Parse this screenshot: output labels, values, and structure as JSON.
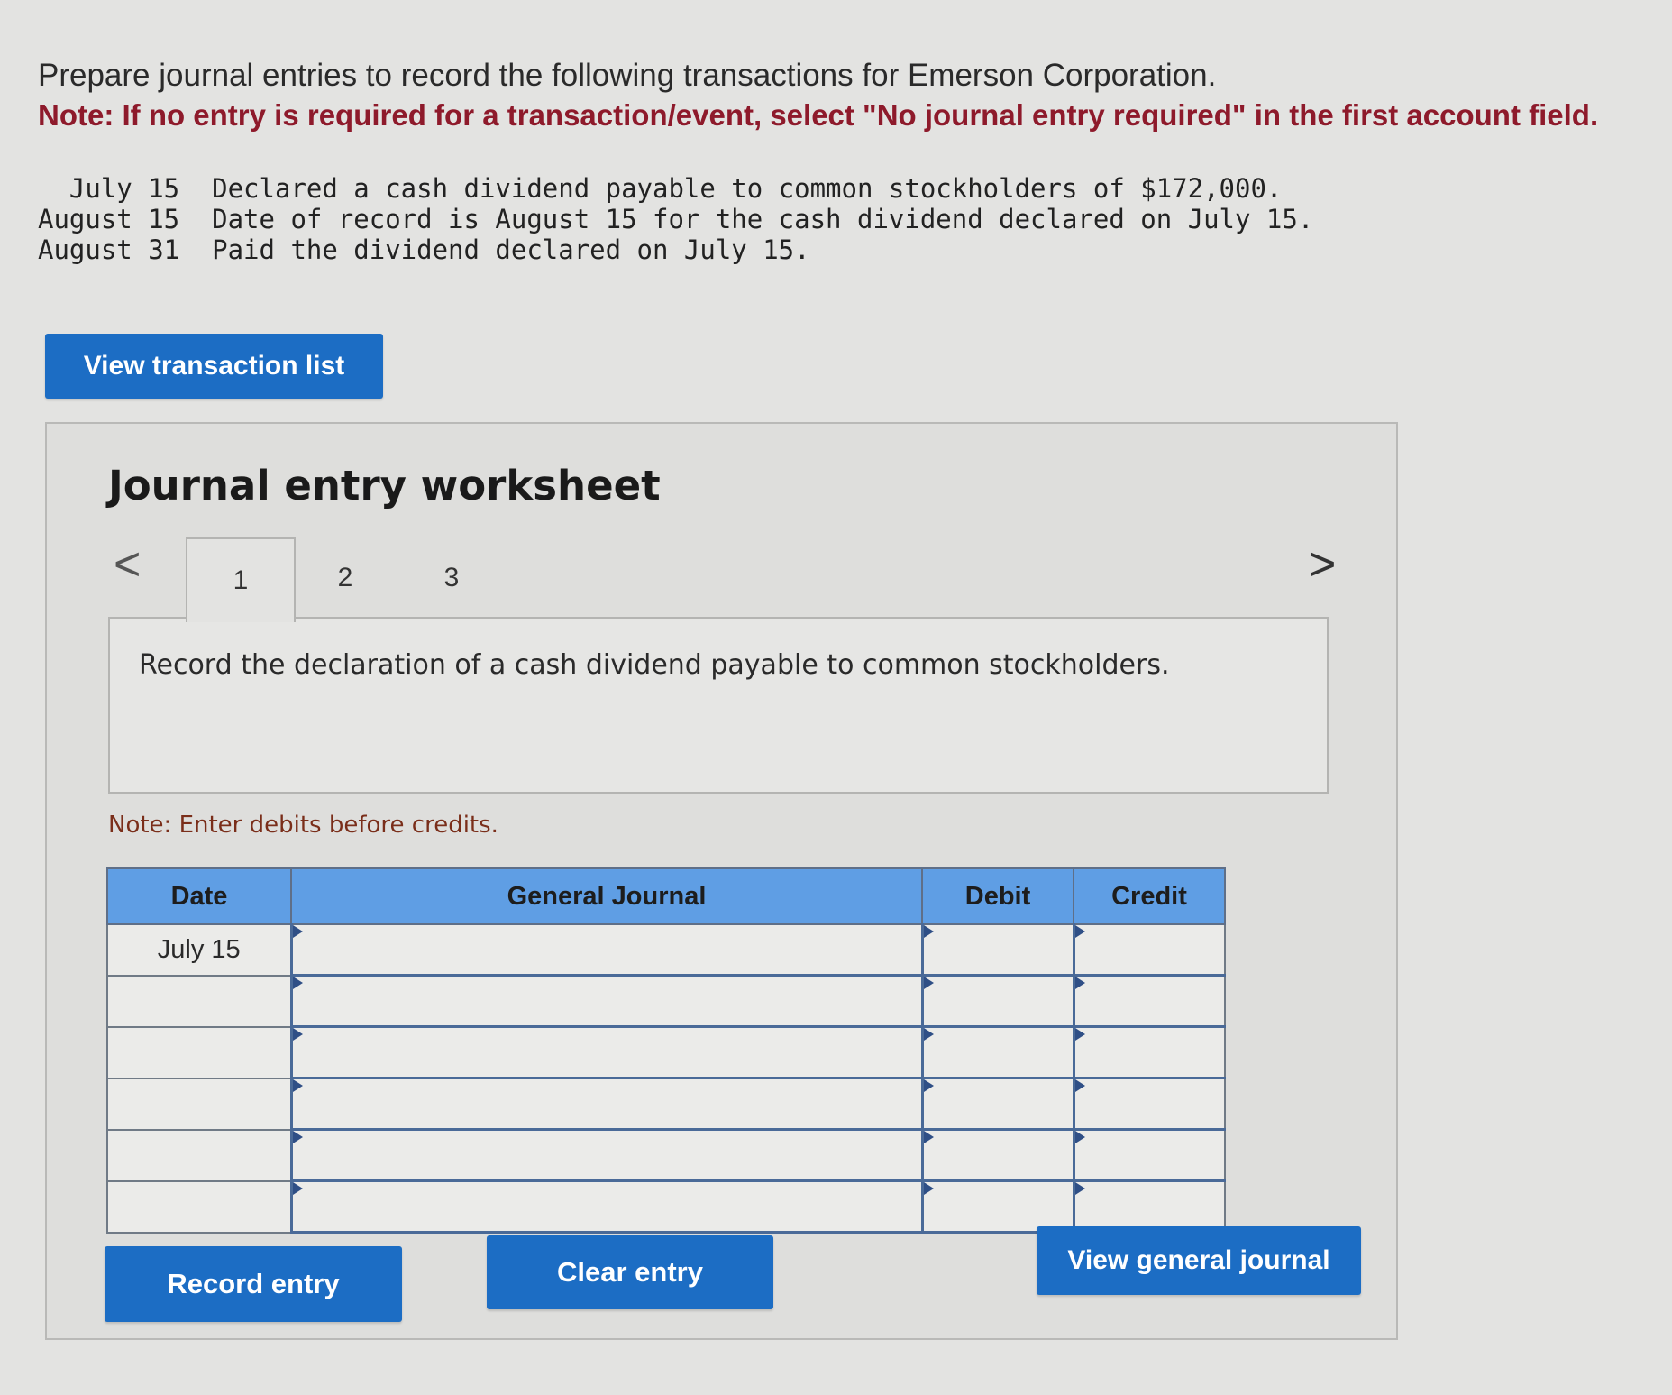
{
  "intro": {
    "line1": "Prepare journal entries to record the following transactions for Emerson Corporation.",
    "note": "Note: If no entry is required for a transaction/event, select \"No journal entry required\" in the first account field."
  },
  "transactions": [
    {
      "date": "July 15",
      "text": "Declared a cash dividend payable to common stockholders of $172,000."
    },
    {
      "date": "August 15",
      "text": "Date of record is August 15 for the cash dividend declared on July 15."
    },
    {
      "date": "August 31",
      "text": "Paid the dividend declared on July 15."
    }
  ],
  "buttons": {
    "view_transaction_list": "View transaction list",
    "record_entry": "Record entry",
    "clear_entry": "Clear entry",
    "view_general_journal": "View general journal"
  },
  "worksheet": {
    "title": "Journal entry worksheet",
    "tabs": [
      "1",
      "2",
      "3"
    ],
    "active_tab": "1",
    "prev_arrow": "<",
    "next_arrow": ">",
    "instruction": "Record the declaration of a cash dividend payable to common stockholders.",
    "note": "Note: Enter debits before credits."
  },
  "journal": {
    "headers": {
      "date": "Date",
      "account": "General Journal",
      "debit": "Debit",
      "credit": "Credit"
    },
    "rows": [
      {
        "date": "July 15",
        "account": "",
        "debit": "",
        "credit": ""
      },
      {
        "date": "",
        "account": "",
        "debit": "",
        "credit": ""
      },
      {
        "date": "",
        "account": "",
        "debit": "",
        "credit": ""
      },
      {
        "date": "",
        "account": "",
        "debit": "",
        "credit": ""
      },
      {
        "date": "",
        "account": "",
        "debit": "",
        "credit": ""
      },
      {
        "date": "",
        "account": "",
        "debit": "",
        "credit": ""
      }
    ]
  },
  "colors": {
    "button_blue": "#1c6dc4",
    "header_blue": "#5f9ee4",
    "note_red": "#8e1a2b"
  }
}
